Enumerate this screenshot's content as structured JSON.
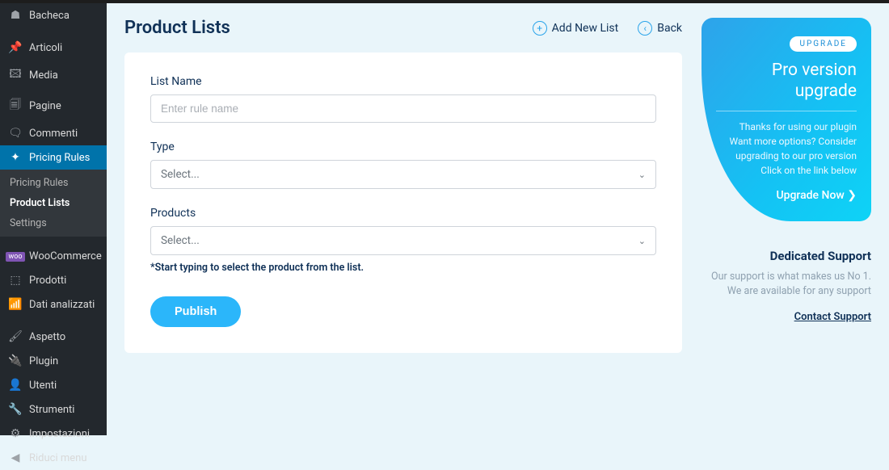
{
  "sidebar": {
    "items": [
      {
        "label": "Bacheca",
        "icon": "⌂"
      },
      {
        "label": "Articoli",
        "icon": "✎"
      },
      {
        "label": "Media",
        "icon": "▣"
      },
      {
        "label": "Pagine",
        "icon": "🗎"
      },
      {
        "label": "Commenti",
        "icon": "💬"
      },
      {
        "label": "Pricing Rules",
        "icon": "⟨"
      },
      {
        "label": "WooCommerce",
        "icon": "woo"
      },
      {
        "label": "Prodotti",
        "icon": "⬚"
      },
      {
        "label": "Dati analizzati",
        "icon": "📊"
      },
      {
        "label": "Aspetto",
        "icon": "✎"
      },
      {
        "label": "Plugin",
        "icon": "🔌"
      },
      {
        "label": "Utenti",
        "icon": "👤"
      },
      {
        "label": "Strumenti",
        "icon": "🔧"
      },
      {
        "label": "Impostazioni",
        "icon": "⚙"
      },
      {
        "label": "Riduci menu",
        "icon": "⟲"
      }
    ],
    "sub": [
      {
        "label": "Pricing Rules"
      },
      {
        "label": "Product Lists"
      },
      {
        "label": "Settings"
      }
    ]
  },
  "header": {
    "title": "Product Lists",
    "add_new": "Add New List",
    "back": "Back"
  },
  "form": {
    "list_name_label": "List Name",
    "list_name_placeholder": "Enter rule name",
    "type_label": "Type",
    "type_placeholder": "Select...",
    "products_label": "Products",
    "products_placeholder": "Select...",
    "products_hint": "*Start typing to select the product from the list.",
    "publish_label": "Publish"
  },
  "upgrade": {
    "badge": "UPGRADE",
    "title1": "Pro version",
    "title2": "upgrade",
    "text1": "Thanks for using our plugin",
    "text2": "Want more options? Consider",
    "text3": "upgrading to our pro version",
    "text4": "Click on the link below",
    "cta": "Upgrade Now ❯"
  },
  "support": {
    "title": "Dedicated Support",
    "text": "Our support is what makes us No 1. We are available for any support",
    "link": "Contact Support"
  }
}
